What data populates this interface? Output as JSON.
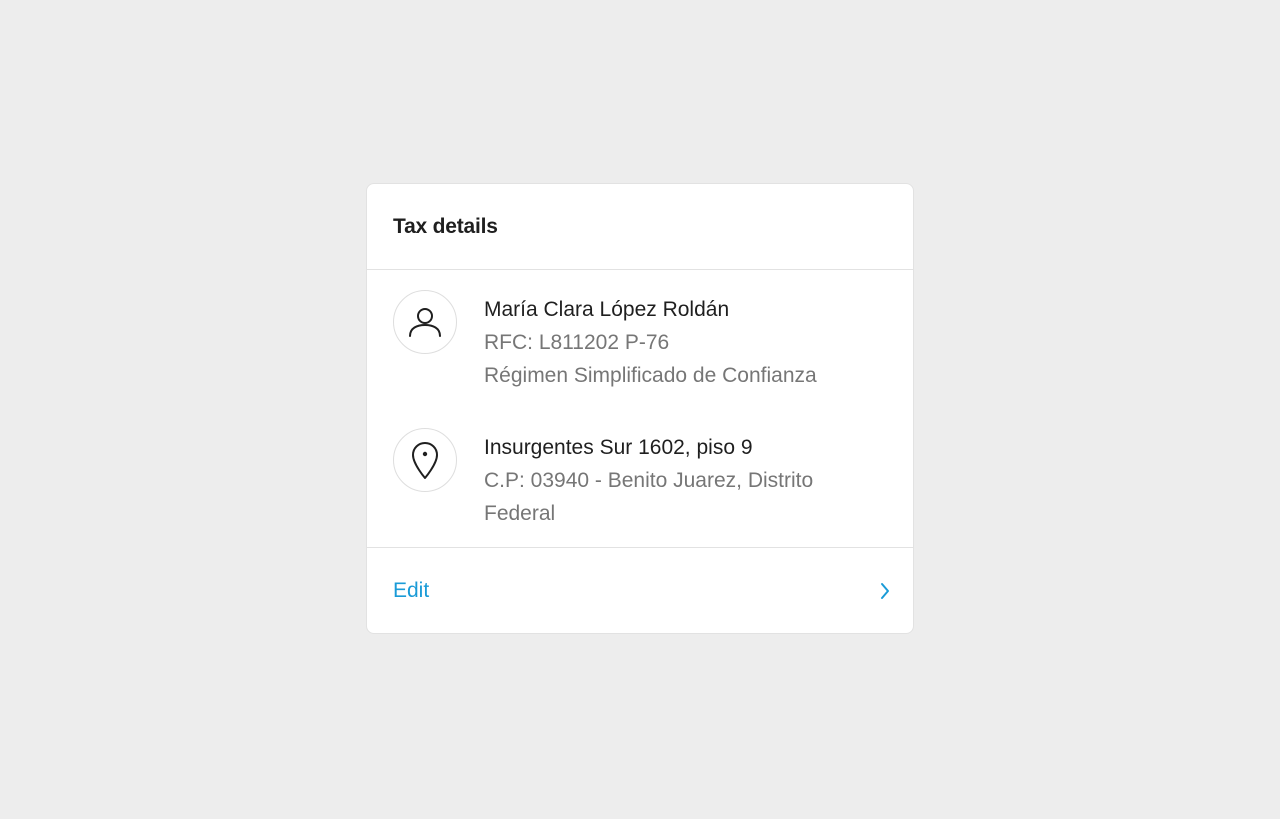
{
  "card": {
    "title": "Tax details",
    "taxpayer": {
      "icon": "user-icon",
      "name": "María Clara López Roldán",
      "rfc": "RFC: L811202 P-76",
      "regime": "Régimen Simplificado de Confianza"
    },
    "address": {
      "icon": "location-pin-icon",
      "street": "Insurgentes Sur 1602, piso 9",
      "locality_line1": "C.P: 03940 - Benito Juarez, Distrito",
      "locality_line2": "Federal"
    },
    "footer": {
      "edit_label": "Edit",
      "icon": "chevron-right-icon"
    }
  },
  "colors": {
    "background": "#ededed",
    "card": "#ffffff",
    "primary_text": "#1f1f1f",
    "secondary_text": "#767676",
    "accent": "#1a9bd7",
    "divider": "#e2e2e2"
  }
}
